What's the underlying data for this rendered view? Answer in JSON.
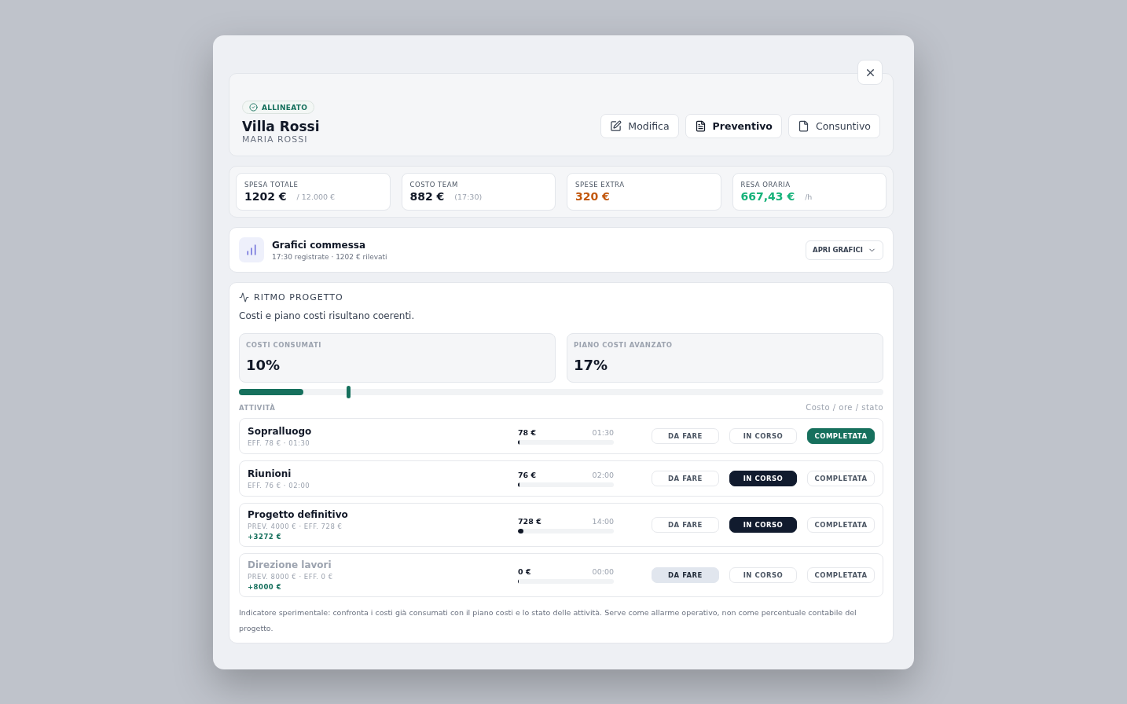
{
  "header": {
    "badge": "ALLINEATO",
    "title": "Villa Rossi",
    "client": "MARIA ROSSI",
    "actions": [
      {
        "kind": "edit",
        "label": "Modifica",
        "emphasis": false
      },
      {
        "kind": "quote",
        "label": "Preventivo",
        "emphasis": true
      },
      {
        "kind": "final",
        "label": "Consuntivo",
        "emphasis": false
      }
    ]
  },
  "stats": [
    {
      "label": "SPESA TOTALE",
      "value": "1202 €",
      "suffix": "/ 12.000 €",
      "color": "#111827"
    },
    {
      "label": "COSTO TEAM",
      "value": "882 €",
      "suffix": "(17:30)",
      "color": "#111827"
    },
    {
      "label": "SPESE EXTRA",
      "value": "320 €",
      "color": "#c2570c"
    },
    {
      "label": "RESA ORARIA",
      "value": "667,43 €",
      "suffix": "/h",
      "color": "#16b27a"
    }
  ],
  "charts_panel": {
    "title": "Grafici commessa",
    "subtitle": "17:30 registrate · 1202 € rilevati",
    "button": "APRI GRAFICI"
  },
  "rhythm": {
    "title": "RITMO PROGETTO",
    "summary": "Costi e piano costi risultano coerenti.",
    "metrics": [
      {
        "label": "COSTI CONSUMATI",
        "value": "10%",
        "level": 0.1
      },
      {
        "label": "PIANO COSTI AVANZATO",
        "value": "17%",
        "level": 0.17
      }
    ],
    "activities_label": "ATTIVITÀ",
    "columns_label": "Costo / ore / stato",
    "activities": [
      {
        "name": "Sopralluogo",
        "detail": "EFF. 78 € · 01:30",
        "cost": "78 €",
        "hours": "01:30",
        "level": 0.005,
        "dimmed": false,
        "status": [
          {
            "kind": "todo",
            "label": "DA FARE",
            "selected": false
          },
          {
            "kind": "doing",
            "label": "IN CORSO",
            "selected": false
          },
          {
            "kind": "done",
            "label": "COMPLETATA",
            "selected": true
          }
        ]
      },
      {
        "name": "Riunioni",
        "detail": "EFF. 76 € · 02:00",
        "cost": "76 €",
        "hours": "02:00",
        "level": 0.005,
        "dimmed": false,
        "status": [
          {
            "kind": "todo",
            "label": "DA FARE",
            "selected": false
          },
          {
            "kind": "doing",
            "label": "IN CORSO",
            "selected": true
          },
          {
            "kind": "done",
            "label": "COMPLETATA",
            "selected": false
          }
        ]
      },
      {
        "name": "Progetto definitivo",
        "detail": "PREV. 4000 € · EFF. 728 €",
        "delta": "+3272 €",
        "cost": "728 €",
        "hours": "14:00",
        "level": 0.06,
        "dimmed": false,
        "status": [
          {
            "kind": "todo",
            "label": "DA FARE",
            "selected": false
          },
          {
            "kind": "doing",
            "label": "IN CORSO",
            "selected": true
          },
          {
            "kind": "done",
            "label": "COMPLETATA",
            "selected": false
          }
        ]
      },
      {
        "name": "Direzione lavori",
        "detail": "PREV. 8000 € · EFF. 0 €",
        "delta": "+8000 €",
        "cost": "0 €",
        "hours": "00:00",
        "level": 0,
        "dimmed": true,
        "status": [
          {
            "kind": "todo",
            "label": "DA FARE",
            "selected": true
          },
          {
            "kind": "doing",
            "label": "IN CORSO",
            "selected": false
          },
          {
            "kind": "done",
            "label": "COMPLETATA",
            "selected": false
          }
        ]
      }
    ],
    "note": "Indicatore sperimentale: confronta i costi già consumati con il piano costi e lo stato delle attività. Serve come allarme operativo, non come percentuale contabile del progetto."
  }
}
